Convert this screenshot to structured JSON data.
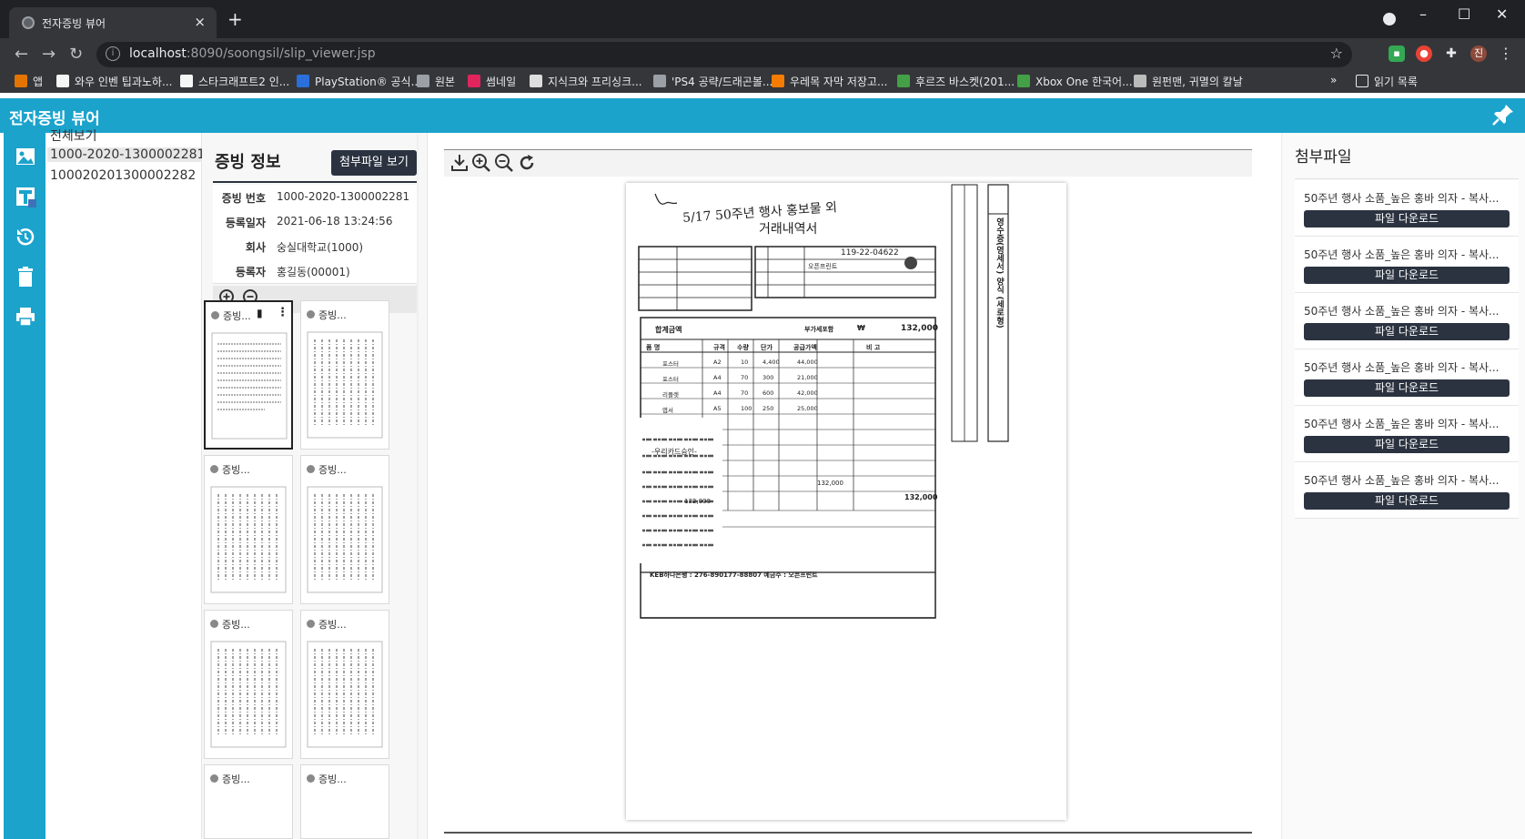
{
  "browser": {
    "tab_title": "전자증빙 뷰어",
    "tab_close": "×",
    "new_tab": "+",
    "url_host": "localhost",
    "url_path": ":8090/soongsil/slip_viewer.jsp",
    "profile_initial": "진",
    "bookmarks": [
      {
        "label": "앱",
        "color": "#e37400"
      },
      {
        "label": "와우 인벤 팁과노하...",
        "color": "#f5f5f5"
      },
      {
        "label": "스타크래프트2 인...",
        "color": "#f5f5f5"
      },
      {
        "label": "PlayStation® 공식...",
        "color": "#2a6fdb"
      },
      {
        "label": "원본",
        "color": "#9aa0a6"
      },
      {
        "label": "썸네일",
        "color": "#e0245e"
      },
      {
        "label": "지식크와 프리싱크...",
        "color": "#dddddd"
      },
      {
        "label": "'PS4 공략/드래곤볼...",
        "color": "#9aa0a6"
      },
      {
        "label": "우레목 자막 저장고...",
        "color": "#f57c00"
      },
      {
        "label": "후르즈 바스켓(201...",
        "color": "#43a047"
      },
      {
        "label": "Xbox One 한국어...",
        "color": "#43a047"
      },
      {
        "label": "원펀맨, 귀멸의 칼날",
        "color": "#bbbbbb"
      }
    ],
    "bookmarks_more": "»",
    "reading_list": "읽기 목록"
  },
  "app": {
    "title": "전자증빙 뷰어",
    "accent_color": "#1ba3cc",
    "dark_button_color": "#2b3340"
  },
  "slip_list": {
    "all_label": "전체보기",
    "items": [
      "1000-2020-1300002281",
      "100020201300002282"
    ]
  },
  "info": {
    "title": "증빙 정보",
    "attach_button": "첨부파일 보기",
    "rows": [
      {
        "label": "증빙 번호",
        "value": "1000-2020-1300002281"
      },
      {
        "label": "등록일자",
        "value": "2021-06-18 13:24:56"
      },
      {
        "label": "회사",
        "value": "숭실대학교(1000)"
      },
      {
        "label": "등록자",
        "value": "홍길동(00001)"
      }
    ],
    "thumbs": [
      "증빙...",
      "증빙...",
      "증빙...",
      "증빙...",
      "증빙...",
      "증빙...",
      "증빙...",
      "증빙..."
    ]
  },
  "document": {
    "handwritten_note": "5/17 50주년 행사 홍보물 외",
    "title": "거래내역서",
    "reg_no": "119-22-04622",
    "supplier": "오픈프린트",
    "total_label": "합계금액",
    "vat_label": "부가세포함",
    "total_currency": "₩",
    "total_amount": "132,000",
    "col_headers": [
      "품 명",
      "규격",
      "수량",
      "단가",
      "공급가액",
      "비 고"
    ],
    "items": [
      {
        "name": "포스터",
        "spec": "A2",
        "qty": "10",
        "price": "4,400",
        "amount": "44,000"
      },
      {
        "name": "포스터",
        "spec": "A4",
        "qty": "70",
        "price": "300",
        "amount": "21,000"
      },
      {
        "name": "리플렛",
        "spec": "A4",
        "qty": "70",
        "price": "600",
        "amount": "42,000"
      },
      {
        "name": "엽서",
        "spec": "A5",
        "qty": "100",
        "price": "250",
        "amount": "25,000"
      }
    ],
    "subtotal": "132,000",
    "total_row": "132,000",
    "receipt_title": "-우리카드승인-",
    "receipt_amount": "132,000",
    "bank_line": "KEB하나은행 : 276-890177-88807   예금주 : 오픈프린트",
    "side_text": "영수증(영세서) 양식 (세로형)"
  },
  "attachments": {
    "title": "첨부파일",
    "files": [
      {
        "name": "50주년 행사 소품_높은 홍바 의자 - 복사...",
        "button": "파일 다운로드"
      },
      {
        "name": "50주년 행사 소품_높은 홍바 의자 - 복사...",
        "button": "파일 다운로드"
      },
      {
        "name": "50주년 행사 소품_높은 홍바 의자 - 복사...",
        "button": "파일 다운로드"
      },
      {
        "name": "50주년 행사 소품_높은 홍바 의자 - 복사...",
        "button": "파일 다운로드"
      },
      {
        "name": "50주년 행사 소품_높은 홍바 의자 - 복사...",
        "button": "파일 다운로드"
      },
      {
        "name": "50주년 행사 소품_높은 홍바 의자 - 복사...",
        "button": "파일 다운로드"
      }
    ]
  },
  "icons": {
    "sidebar": [
      "image-icon",
      "text-icon",
      "history-icon",
      "trash-icon",
      "print-icon"
    ],
    "viewer": [
      "download-icon",
      "zoom-in-icon",
      "zoom-out-icon",
      "rotate-icon"
    ]
  }
}
